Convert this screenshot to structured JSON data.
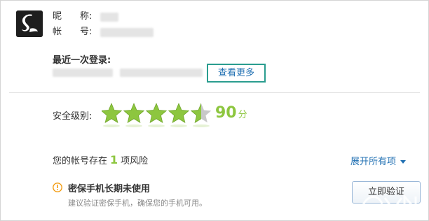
{
  "profile": {
    "nickname_label": "昵",
    "nickname_label_2": "称:",
    "account_label": "帐",
    "account_label_2": "号:"
  },
  "last_login": {
    "title": "最近一次登录:",
    "view_more_label": "查看更多"
  },
  "security": {
    "level_label": "安全级别:",
    "stars": 4.5,
    "stars_max": 5,
    "score": "90",
    "score_unit": "分",
    "star_color": "#8dc63f"
  },
  "risks": {
    "prefix": "您的帐号存在",
    "count": "1",
    "suffix": "项风险",
    "expand_all_label": "展开所有项",
    "items": [
      {
        "title": "密保手机长期未使用",
        "description": "建议验证密保手机，确保您的手机可用。",
        "action_label": "立即验证",
        "icon": "warning-icon"
      }
    ]
  },
  "colors": {
    "accent_green": "#8dc63f",
    "link_blue": "#1f6fb2",
    "highlight_teal": "#2a9d8f",
    "warning_orange": "#f39c12"
  }
}
